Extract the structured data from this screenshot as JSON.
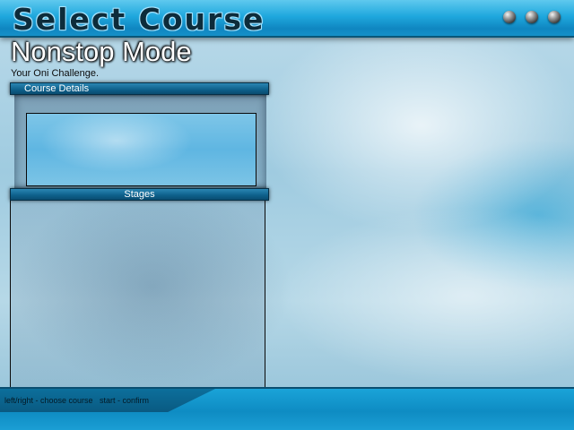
{
  "header": {
    "title": "Select Course",
    "indicator_icons": [
      "indicator-dot-icon",
      "indicator-dot-icon",
      "indicator-dot-icon"
    ]
  },
  "mode": {
    "title": "Nonstop Mode",
    "description": "Your Oni Challenge."
  },
  "course_details": {
    "header_label": "Course Details",
    "content": ""
  },
  "stages": {
    "header_label": "Stages",
    "items": []
  },
  "footer": {
    "hint": "left/right - choose course   start - confirm"
  },
  "colors": {
    "header_blue": "#1fa8de",
    "section_bar": "#0d5f8a",
    "footer_blue": "#0e8cc3"
  }
}
